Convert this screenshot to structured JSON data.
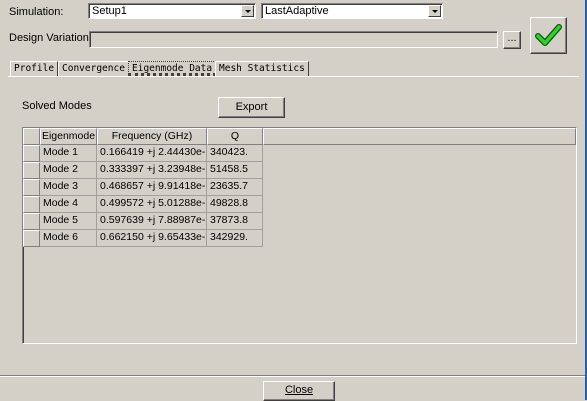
{
  "simulation": {
    "label": "Simulation:",
    "setup": "Setup1",
    "pass": "LastAdaptive"
  },
  "design_variation": {
    "label": "Design Variation:",
    "value": "",
    "browse_label": "..."
  },
  "status_icon": "green-check-icon",
  "tabs": [
    {
      "label": "Profile"
    },
    {
      "label": "Convergence"
    },
    {
      "label": "Eigenmode Data"
    },
    {
      "label": "Mesh Statistics"
    }
  ],
  "main": {
    "solved_modes_label": "Solved Modes",
    "export_label": "Export"
  },
  "table": {
    "columns": [
      "Eigenmode",
      "Frequency (GHz)",
      "Q"
    ],
    "rows": [
      [
        "Mode 1",
        "0.166419 +j 2.44430e-",
        "340423."
      ],
      [
        "Mode 2",
        "0.333397 +j 3.23948e-",
        "51458.5"
      ],
      [
        "Mode 3",
        "0.468657 +j 9.91418e-",
        "23635.7"
      ],
      [
        "Mode 4",
        "0.499572 +j 5.01288e-",
        "49828.8"
      ],
      [
        "Mode 5",
        "0.597639 +j 7.88987e-",
        "37873.8"
      ],
      [
        "Mode 6",
        "0.662150 +j 9.65433e-",
        "342929."
      ]
    ]
  },
  "footer": {
    "close_label": "Close"
  }
}
